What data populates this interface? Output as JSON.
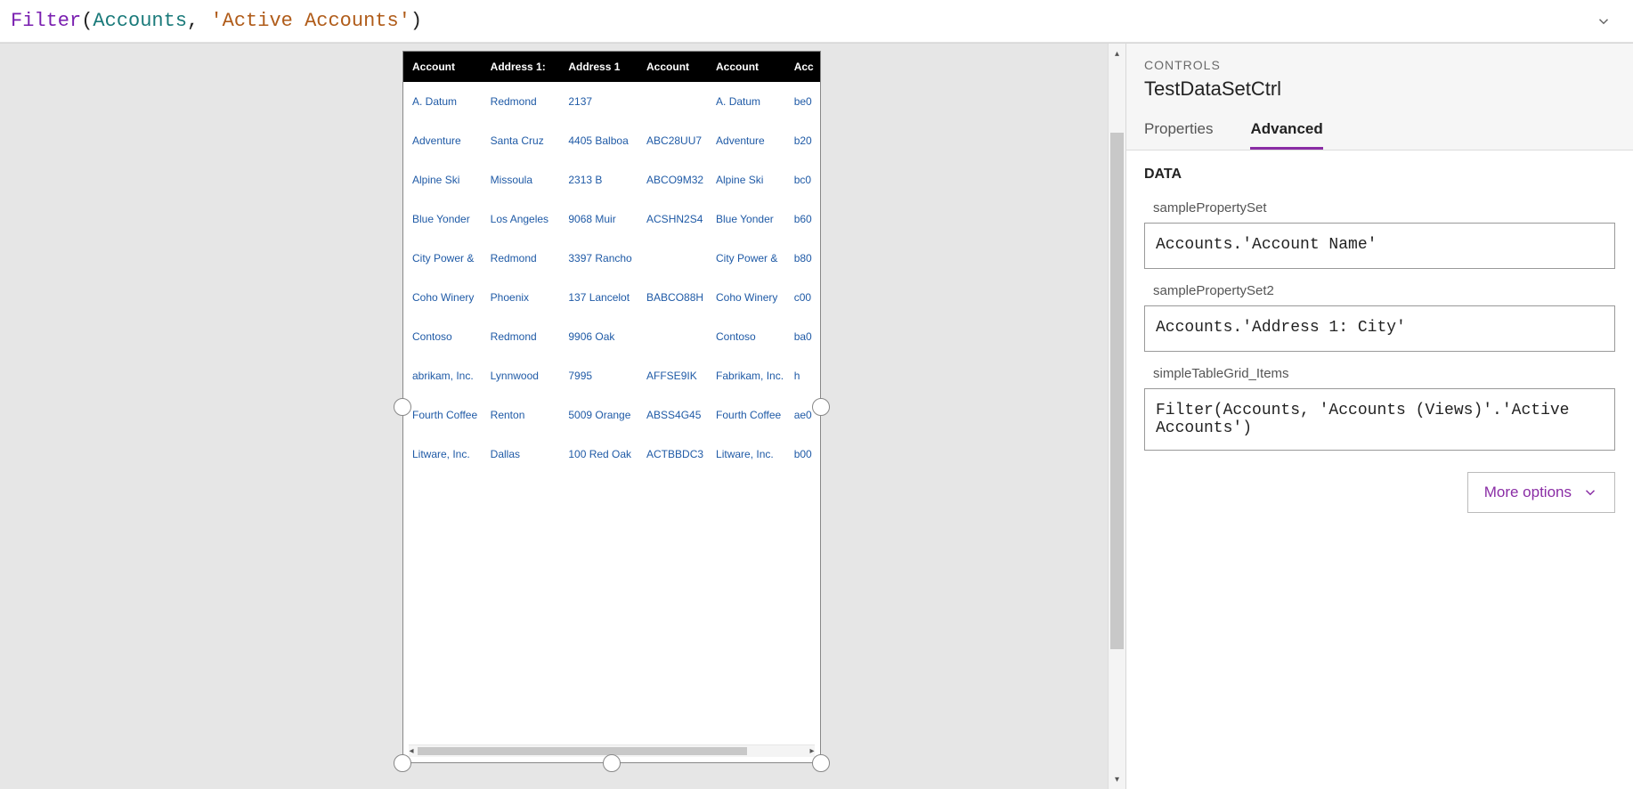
{
  "formula": {
    "fn": "Filter",
    "arg_ident": "Accounts",
    "arg_string": "'Active Accounts'"
  },
  "table": {
    "headers": [
      "Account",
      "Address 1:",
      "Address 1",
      "Account",
      "Account",
      "Acc"
    ],
    "rows": [
      [
        "A. Datum",
        "Redmond",
        "2137",
        "",
        "A. Datum",
        "be0"
      ],
      [
        "Adventure",
        "Santa Cruz",
        "4405 Balboa",
        "ABC28UU7",
        "Adventure",
        "b20"
      ],
      [
        "Alpine Ski",
        "Missoula",
        "2313 B",
        "ABCO9M32",
        "Alpine Ski",
        "bc0"
      ],
      [
        "Blue Yonder",
        "Los Angeles",
        "9068 Muir",
        "ACSHN2S4",
        "Blue Yonder",
        "b60"
      ],
      [
        "City Power &",
        "Redmond",
        "3397 Rancho",
        "",
        "City Power &",
        "b80"
      ],
      [
        "Coho Winery",
        "Phoenix",
        "137 Lancelot",
        "BABCO88H",
        "Coho Winery",
        "c00"
      ],
      [
        "Contoso",
        "Redmond",
        "9906 Oak",
        "",
        "Contoso",
        "ba0"
      ],
      [
        "abrikam, Inc.",
        "Lynnwood",
        "7995",
        "AFFSE9IK",
        "Fabrikam, Inc.",
        "h"
      ],
      [
        "Fourth Coffee",
        "Renton",
        "5009 Orange",
        "ABSS4G45",
        "Fourth Coffee",
        "ae0"
      ],
      [
        "Litware, Inc.",
        "Dallas",
        "100 Red Oak",
        "ACTBBDC3",
        "Litware, Inc.",
        "b00"
      ]
    ]
  },
  "panel": {
    "eyebrow": "CONTROLS",
    "title": "TestDataSetCtrl",
    "tabs": {
      "properties": "Properties",
      "advanced": "Advanced"
    },
    "section": "DATA",
    "props": {
      "p1": {
        "label": "samplePropertySet",
        "value": "Accounts.'Account Name'"
      },
      "p2": {
        "label": "samplePropertySet2",
        "value": "Accounts.'Address 1: City'"
      },
      "p3": {
        "label": "simpleTableGrid_Items",
        "value": "Filter(Accounts, 'Accounts (Views)'.'Active Accounts')"
      }
    },
    "more_options": "More options"
  }
}
